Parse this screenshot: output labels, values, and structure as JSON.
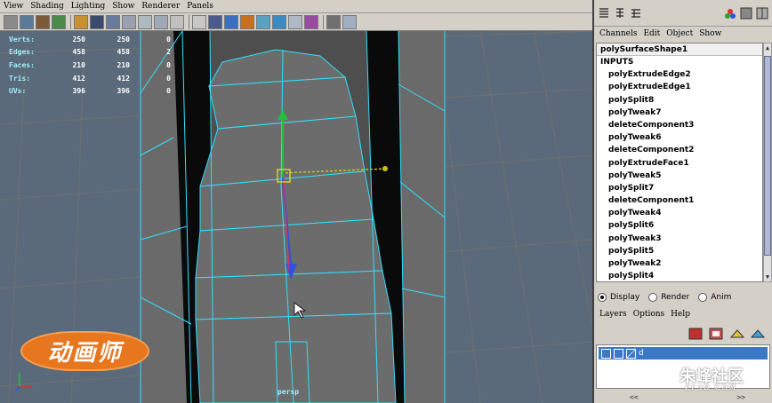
{
  "viewport": {
    "menu": [
      "View",
      "Shading",
      "Lighting",
      "Show",
      "Renderer",
      "Panels"
    ],
    "hud": [
      {
        "label": "Verts:",
        "a": "250",
        "b": "250",
        "c": "0"
      },
      {
        "label": "Edges:",
        "a": "458",
        "b": "458",
        "c": "2"
      },
      {
        "label": "Faces:",
        "a": "210",
        "b": "210",
        "c": "0"
      },
      {
        "label": "Tris:",
        "a": "412",
        "b": "412",
        "c": "0"
      },
      {
        "label": "UVs:",
        "a": "396",
        "b": "396",
        "c": "0"
      }
    ],
    "camera_label": "persp",
    "logo_text": "动画师"
  },
  "panel": {
    "menu": [
      "Channels",
      "Edit",
      "Object",
      "Show"
    ],
    "shape_name": "polySurfaceShape1",
    "inputs_header": "INPUTS",
    "history": [
      "polyExtrudeEdge2",
      "polyExtrudeEdge1",
      "polySplit8",
      "polyTweak7",
      "deleteComponent3",
      "polyTweak6",
      "deleteComponent2",
      "polyExtrudeFace1",
      "polyTweak5",
      "polySplit7",
      "deleteComponent1",
      "polyTweak4",
      "polySplit6",
      "polyTweak3",
      "polySplit5",
      "polyTweak2",
      "polySplit4"
    ],
    "modes": {
      "display": "Display",
      "render": "Render",
      "anim": "Anim",
      "selected": "display"
    },
    "layers_menu": [
      "Layers",
      "Options",
      "Help"
    ],
    "layer_name": "d",
    "nav_left": "<<",
    "nav_right": ">>"
  },
  "watermark": {
    "text": "朱峰社区",
    "sub": "ZF3D.COM"
  },
  "colors": {
    "viewport_bg": "#5a6a7a",
    "wire": "#2fe0ff",
    "mesh_face": "#6e6e6e",
    "accent": "#e8761f",
    "layer_highlight": "#3c78c8"
  }
}
